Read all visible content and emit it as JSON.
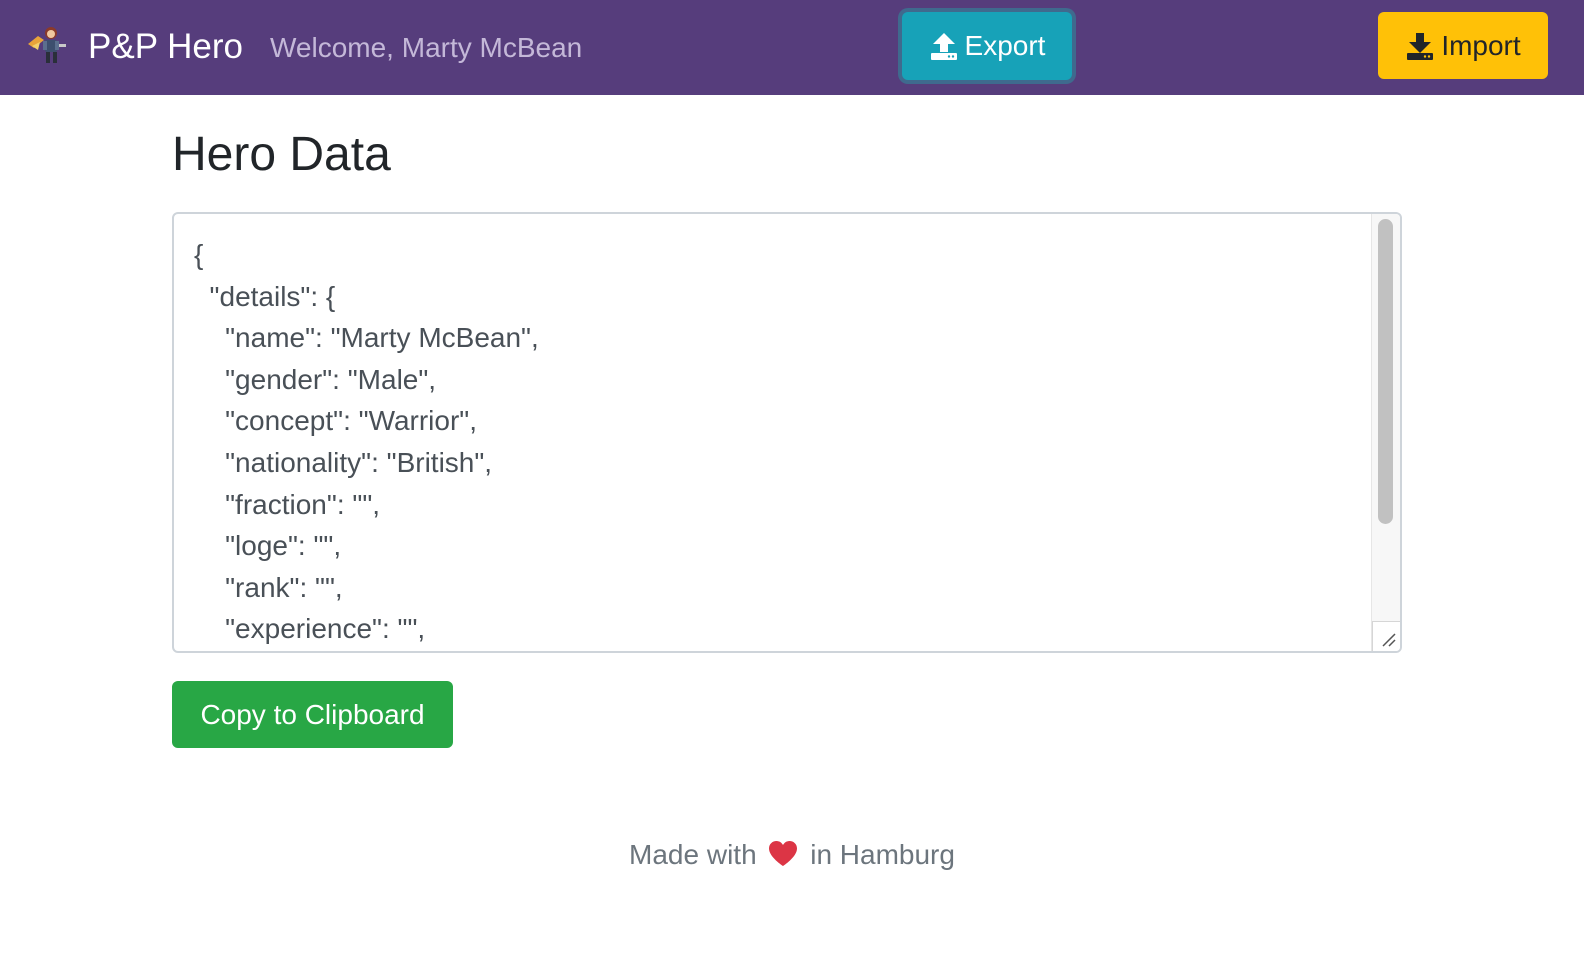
{
  "navbar": {
    "brand": "P&P Hero",
    "welcome": "Welcome, Marty McBean",
    "logo_icon": "hero-character-icon",
    "export_label": "Export",
    "export_icon": "upload-icon",
    "import_label": "Import",
    "import_icon": "download-icon"
  },
  "main": {
    "title": "Hero Data",
    "json_text": "{\n  \"details\": {\n    \"name\": \"Marty McBean\",\n    \"gender\": \"Male\",\n    \"concept\": \"Warrior\",\n    \"nationality\": \"British\",\n    \"fraction\": \"\",\n    \"loge\": \"\",\n    \"rank\": \"\",\n    \"experience\": \"\",\n    \"ident\": \"\",",
    "copy_label": "Copy to Clipboard"
  },
  "footer": {
    "prefix": "Made with",
    "heart_icon": "heart-icon",
    "suffix": "in Hamburg"
  },
  "colors": {
    "navbar_bg": "#563d7c",
    "export_bg": "#17a2b8",
    "import_bg": "#ffc107",
    "copy_bg": "#28a745",
    "heart": "#dc3545"
  }
}
